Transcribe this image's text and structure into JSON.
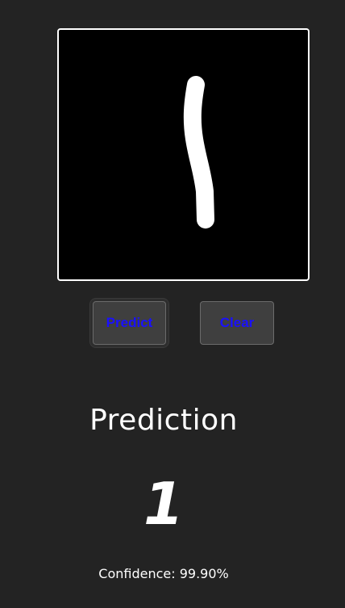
{
  "drawing_canvas": {
    "background": "#000000",
    "stroke_color": "#ffffff"
  },
  "buttons": {
    "predict_label": "Predict",
    "clear_label": "Clear",
    "label_color": "#1a10ff"
  },
  "result": {
    "title": "Prediction",
    "digit": "1",
    "confidence_text": "Confidence: 99.90%"
  }
}
